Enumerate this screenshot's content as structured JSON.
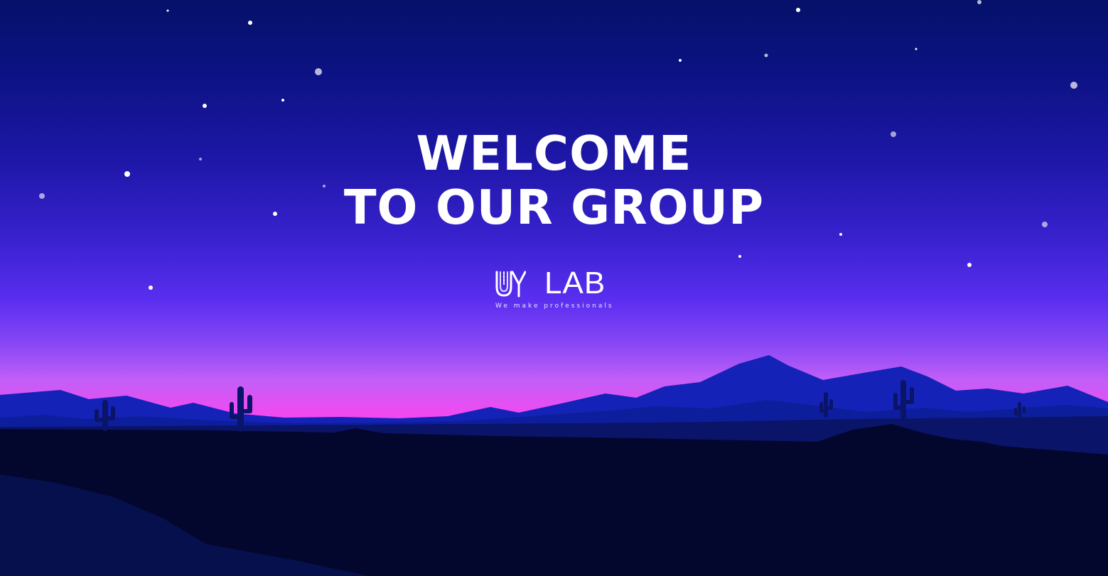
{
  "headline": {
    "line1": "WELCOME",
    "line2": "TO OUR GROUP"
  },
  "logo": {
    "mark_letters": "UY",
    "wordmark": "LAB",
    "tagline": "We make professionals"
  },
  "colors": {
    "sky_top": "#05116a",
    "sky_mid": "#3a22d0",
    "horizon_glow": "#f545ef",
    "mountains": "#0f22b0",
    "ground": "#020424",
    "text": "#ffffff"
  }
}
